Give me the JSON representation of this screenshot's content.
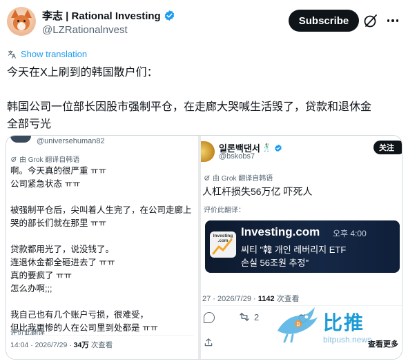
{
  "header": {
    "display_name": "李志 | Rational Investing",
    "handle": "@LZRationalnvest",
    "subscribe_label": "Subscribe",
    "avatar_icon": "fox-avatar",
    "verified_icon": "verified-badge-icon",
    "grok_icon": "grok-icon",
    "more_icon": "more-icon"
  },
  "tweet": {
    "show_translation": "Show translation",
    "line1": "今天在X上刷到的韩国散户们：",
    "line2": "韩国公司一位部长因股市强制平仓，在走廊大哭喊生活毁了，贷款和退休金",
    "line3": "全部亏光"
  },
  "media": {
    "left": {
      "handle": "@universehuman82",
      "translated_by": "由 Grok 翻译自韩语",
      "lines": [
        "啊。今天真的很严重 ㅠㅠ",
        "公司紧急状态 ㅠㅠ",
        "",
        "被强制平仓后，尖叫着人生完了，在公司走廊上",
        "哭的部长们就在那里 ㅠㅠ",
        "",
        "贷款都用光了，说没钱了。",
        "连退休金都全砸进去了 ㅠㅠ",
        "真的要疯了 ㅠㅠ",
        "怎么办啊;;;",
        "",
        "我自己也有几个账户亏损，很难受，",
        "但比我更惨的人在公司里到处都是 ㅠㅠ"
      ],
      "rate_translation": "评价此翻译",
      "time": "14:04 · 2026/7/29 · ",
      "views": "34万",
      "views_label": " 次查看"
    },
    "right": {
      "name": "일론백댄서",
      "name_emoji": "🕺",
      "handle": "@bskobs7",
      "follow_label": "关注",
      "translated_by": "由 Grok 翻译自韩语",
      "text": "人杠杆损失56万亿 吓死人",
      "rate_translation": "评价此翻译：",
      "card_title": "Investing.com",
      "card_time": "오후 4:00",
      "card_logo_text": "Investing .com",
      "card_line1": "씨티 \"韓 개인 레버리지 ETF",
      "card_line2": "손실 56조원 추정\"",
      "meta": "27 · 2026/7/29 · ",
      "views": "1142",
      "views_label": " 次查看",
      "retweet_count": "2",
      "view_more": "查看更多"
    }
  },
  "watermark": {
    "brand": "比推",
    "url": "bitpush.news",
    "colors": {
      "primary": "#1c9bd6"
    }
  },
  "colors": {
    "link": "#1d9bf0",
    "text": "#0f1419",
    "muted": "#536471",
    "verified": "#1d9bf0"
  }
}
